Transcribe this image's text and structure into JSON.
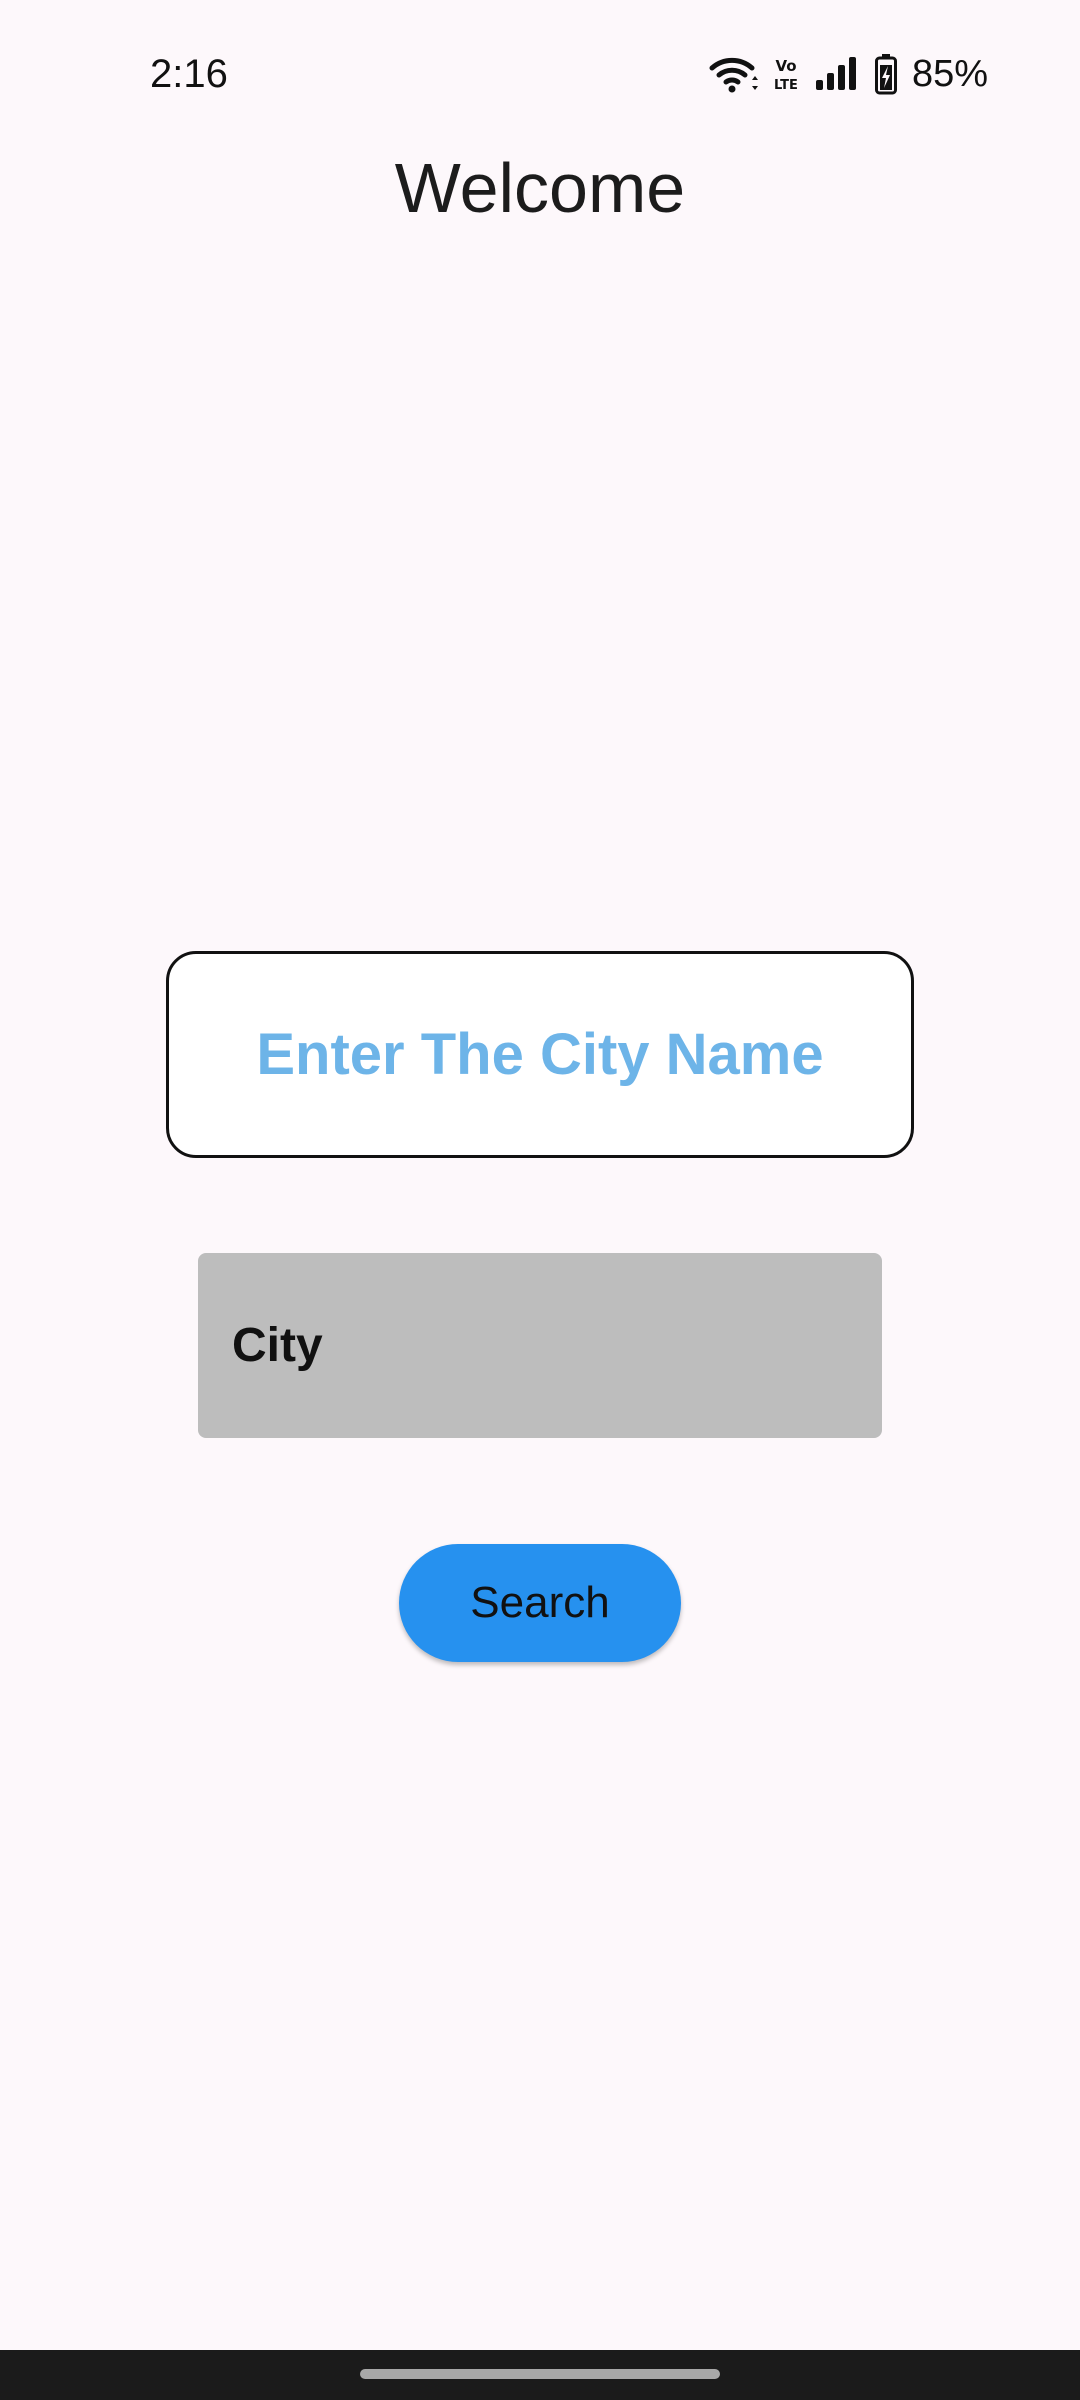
{
  "status_bar": {
    "time": "2:16",
    "network_label": "Vo LTE",
    "battery": "85%",
    "icons": [
      "wifi-icon",
      "volte-icon",
      "signal-icon",
      "battery-charging-icon"
    ]
  },
  "page": {
    "title": "Welcome"
  },
  "prompt": {
    "text": "Enter The City Name",
    "color": "#6db4e8"
  },
  "city_field": {
    "value": "",
    "placeholder": "City",
    "background": "#bdbdbd"
  },
  "search_button": {
    "label": "Search",
    "color": "#2691ef"
  }
}
